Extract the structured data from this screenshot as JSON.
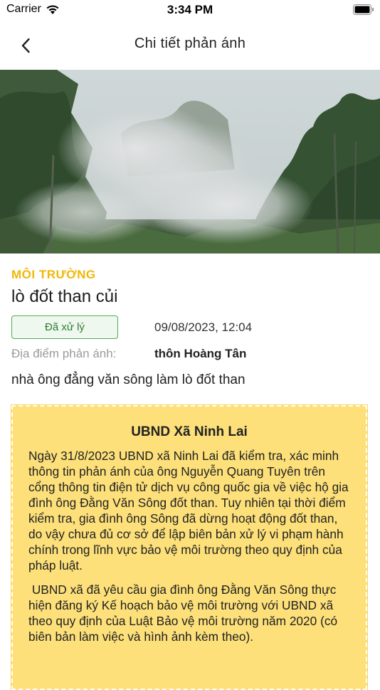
{
  "status_bar": {
    "carrier": "Carrier",
    "time": "3:34 PM"
  },
  "nav": {
    "title": "Chi tiết phản ánh"
  },
  "gallery": {
    "image_description_icon": "smoke-forest-photo",
    "pages": 3,
    "active_page": 1
  },
  "report": {
    "category": "MÔI TRƯỜNG",
    "title": "lò đốt than củi",
    "status": "Đã xử lý",
    "datetime": "09/08/2023, 12:04",
    "location_label": "Địa điểm phản ánh:",
    "location_value": "thôn Hoàng Tân",
    "description": "nhà ông đẳng văn sông làm lò đốt than"
  },
  "response": {
    "title": "UBND Xã Ninh Lai",
    "paragraph_1": "Ngày 31/8/2023 UBND xã Ninh Lai đã kiểm tra, xác minh thông tin phản ánh của ông Nguyễn Quang Tuyên trên cổng thông tin điện tử dịch vụ công quốc gia về việc hộ gia đình ông Đằng Văn Sông đốt than. Tuy nhiên tại thời điểm kiểm tra, gia đình ông Sông đã dừng hoạt động đốt than, do vậy chưa đủ cơ sở để lập biên bản xử lý vi phạm hành chính trong lĩnh vực bảo vệ môi trường theo quy định của pháp luật.",
    "paragraph_2": " UBND xã đã yêu cầu gia đình ông Đằng Văn Sông thực hiện đăng ký Kế hoạch bảo vệ môi trường với UBND xã theo quy định của Luật Bảo vệ môi trường năm 2020 (có biên bản làm việc và hình ảnh kèm theo)."
  },
  "colors": {
    "category": "#f2b705",
    "badge_border": "#4caf50",
    "response_bg": "#fde07a"
  }
}
